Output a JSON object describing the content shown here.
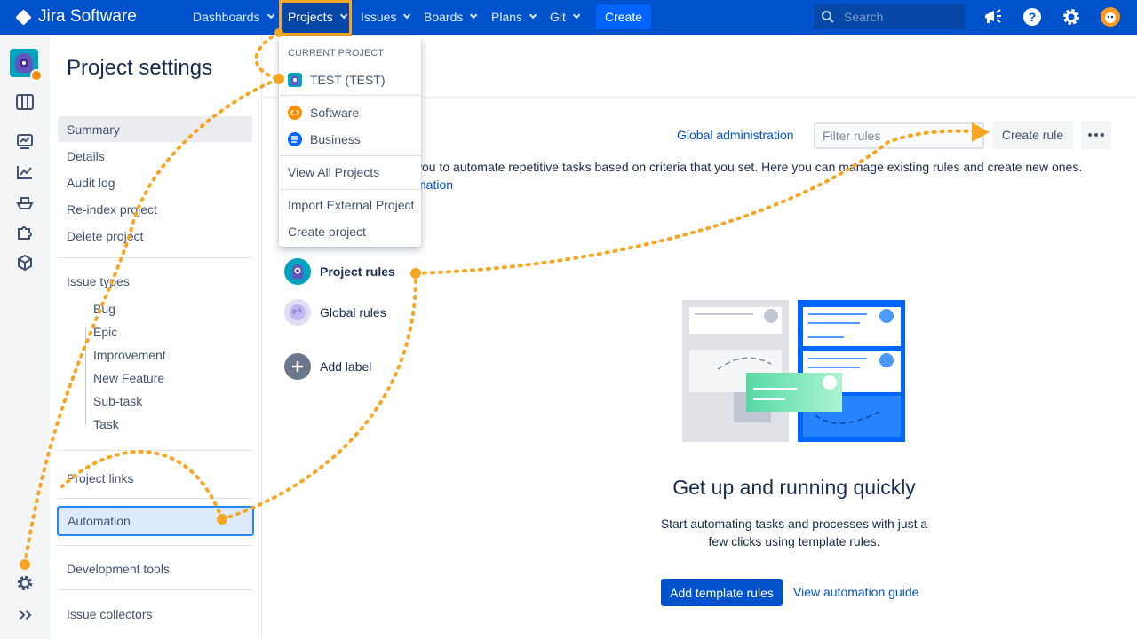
{
  "app": {
    "name": "Jira Software"
  },
  "topnav": {
    "items": [
      {
        "label": "Dashboards"
      },
      {
        "label": "Projects"
      },
      {
        "label": "Issues"
      },
      {
        "label": "Boards"
      },
      {
        "label": "Plans"
      },
      {
        "label": "Git"
      }
    ],
    "create_label": "Create",
    "search_placeholder": "Search",
    "highlight_color": "#f5a623",
    "nav_color": "#0052cc"
  },
  "projects_dropdown": {
    "header": "CURRENT PROJECT",
    "current_project": "TEST (TEST)",
    "items": [
      "Software",
      "Business"
    ],
    "view_all": "View All Projects",
    "import": "Import External Project",
    "create": "Create project"
  },
  "sidebar": {
    "title": "Project settings",
    "items": [
      "Summary",
      "Details",
      "Audit log",
      "Re-index project",
      "Delete project"
    ],
    "issue_types_label": "Issue types",
    "issue_types": [
      "Bug",
      "Epic",
      "Improvement",
      "New Feature",
      "Sub-task",
      "Task"
    ],
    "project_links": "Project links",
    "automation": "Automation",
    "development_tools": "Development tools",
    "issue_collectors": "Issue collectors"
  },
  "main": {
    "global_admin": "Global administration",
    "filter_placeholder": "Filter rules",
    "create_rule": "Create rule",
    "description": "you to automate repetitive tasks based on criteria that you set. Here you can manage existing rules and create new ones.",
    "description_link": "mation",
    "rule_categories": [
      "Project rules",
      "Global rules",
      "Add label"
    ],
    "empty_title": "Get up and running quickly",
    "empty_desc": "Start automating tasks and processes with just a few clicks using template rules.",
    "add_template": "Add template rules",
    "view_guide": "View automation guide"
  }
}
